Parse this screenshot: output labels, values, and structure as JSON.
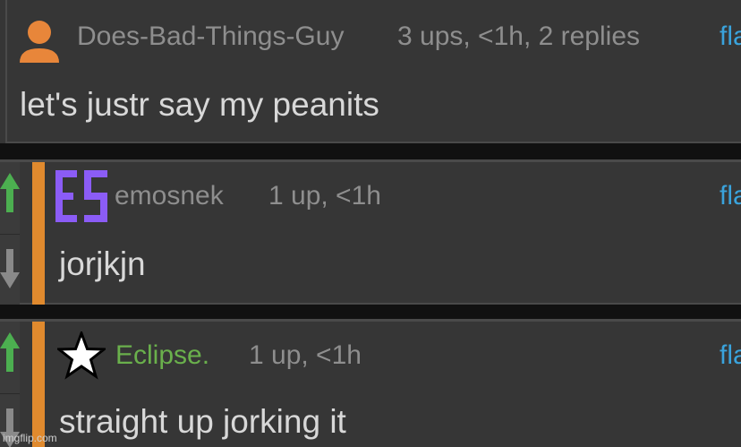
{
  "comments": [
    {
      "username": "Does-Bad-Things-Guy",
      "meta": "3 ups, <1h, 2 replies",
      "text": "let's justr say my peanits",
      "flag_label": "fla",
      "avatar_icon": "user-silhouette-icon"
    },
    {
      "username": "emosnek",
      "meta": "1 up, <1h",
      "text": "jorjkjn",
      "flag_label": "fla",
      "avatar_letters": "ES"
    },
    {
      "username": "Eclipse.",
      "meta": "1 up, <1h",
      "text": "straight up jorking it",
      "flag_label": "fla",
      "avatar_icon": "star-icon"
    }
  ],
  "watermark": "imgflip.com",
  "colors": {
    "accent": "#e08a2e",
    "upvote": "#4caf50",
    "flag": "#3aa3dc",
    "username_green": "#6ab04c",
    "avatar_purple": "#8b5cf6"
  }
}
